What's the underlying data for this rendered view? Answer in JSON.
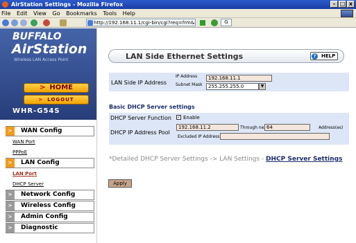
{
  "window": {
    "title": "AirStation Settings - Mozilla Firefox",
    "btn_min": "-",
    "btn_max": "□",
    "btn_close": "x"
  },
  "menubar": {
    "items": [
      "File",
      "Edit",
      "View",
      "Go",
      "Bookmarks",
      "Tools",
      "Help"
    ]
  },
  "toolbar": {
    "url": "http://192.168.11.1/cgi-bin/cgi?req=frm&id=4",
    "search_value": "G"
  },
  "brand": {
    "maker": "BUFFALO",
    "product": "AirStation",
    "tagline": "Wireless LAN Access Point",
    "model": "WHR-G54S"
  },
  "nav": {
    "home": "HOME",
    "logout": "LOGOUT"
  },
  "sidebar": {
    "groups": [
      {
        "label": "WAN Config",
        "style": "orange",
        "icon": "arrow-right-icon"
      },
      {
        "label": "LAN Config",
        "style": "orange",
        "icon": "arrow-right-icon"
      },
      {
        "label": "Network Config",
        "style": "gray",
        "icon": "arrow-right-icon"
      },
      {
        "label": "Wireless Config",
        "style": "gray",
        "icon": "arrow-right-icon"
      },
      {
        "label": "Admin Config",
        "style": "gray",
        "icon": "arrow-right-icon"
      },
      {
        "label": "Diagnostic",
        "style": "gray",
        "icon": "arrow-right-icon"
      }
    ],
    "links": {
      "wan_port": "WAN Port",
      "pppoe": "PPPoE",
      "lan_port": "LAN Port",
      "dhcp_server": "DHCP Server"
    }
  },
  "header": {
    "title": "LAN Side Ethernet Settings",
    "help": "HELP"
  },
  "lan": {
    "label": "LAN Side IP Address",
    "ip_label": "IP Address",
    "ip_value": "192.168.11.1",
    "subnet_label": "Subnet Mask",
    "subnet_value": "255.255.255.0"
  },
  "dhcp": {
    "title": "Basic DHCP Server settings",
    "function_label": "DHCP Server Function",
    "enable_label": "Enable",
    "enabled": true,
    "pool_label": "DHCP IP Address Pool",
    "pool_start": "192.168.11.2",
    "through_label": "Through next",
    "pool_count": "64",
    "addresses_label": "Address(es)",
    "excluded_label": "Excluded IP Address",
    "excluded_value": ""
  },
  "detail": {
    "prefix": "*Detailed DHCP Server Settings -> LAN Settings - ",
    "link": "DHCP Server Settings"
  },
  "apply": "Apply",
  "colors": {
    "sidebar_bg": "#273d7a",
    "form_bg": "#dde6f6",
    "accent_orange": "#f09a1e",
    "field_bg": "#f4e6dc"
  }
}
